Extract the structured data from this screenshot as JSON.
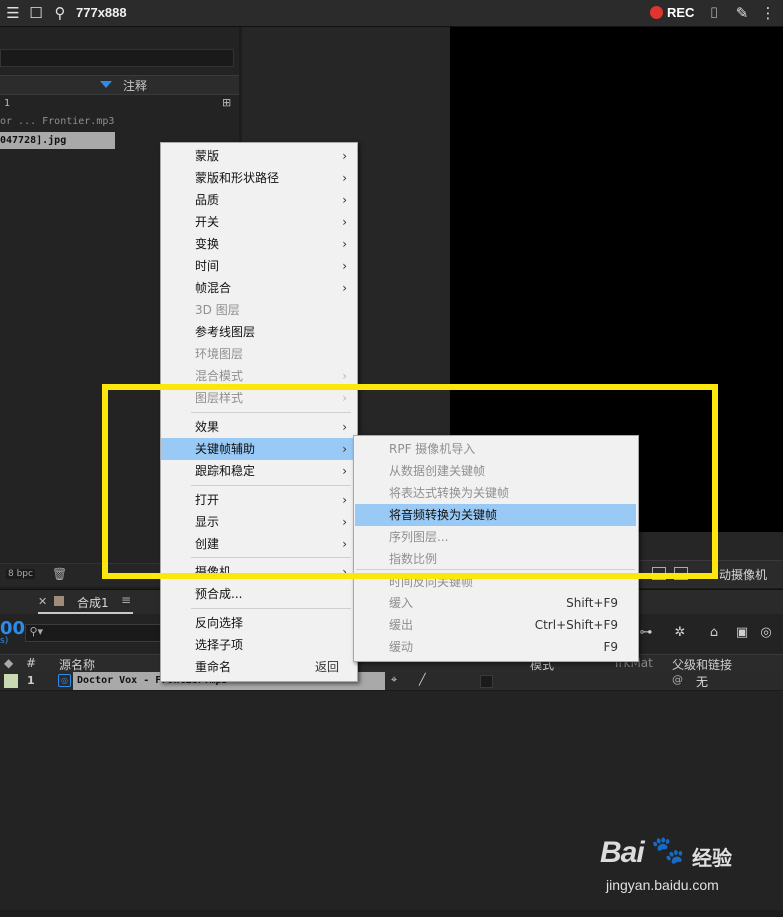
{
  "recorder": {
    "title": "777x888",
    "rec_label": "REC",
    "rec_color": "#e0352f"
  },
  "project_panel": {
    "column_header": "注释",
    "row0": "1",
    "row1": "or ... Frontier.mp3",
    "row2": "047728].jpg",
    "bpc": "8 bpc"
  },
  "comp_viewer": {
    "camera_label": "动摄像机"
  },
  "timeline": {
    "tab_label": "合成1",
    "tab_menu": "≡",
    "time_display": "00",
    "time_sub": "s)",
    "columns": {
      "num": "#",
      "source_name": "源名称",
      "mode": "模式",
      "trkmat": "TrkMat",
      "parent": "父级和链接"
    },
    "layer": {
      "num": "1",
      "name": "Doctor Vox - Frontier.mp3",
      "parent_value": "无",
      "label_color": "#c8d9b4"
    }
  },
  "context_menu": {
    "items": [
      {
        "label": "蒙版",
        "submenu": true
      },
      {
        "label": "蒙版和形状路径",
        "submenu": true
      },
      {
        "label": "品质",
        "submenu": true
      },
      {
        "label": "开关",
        "submenu": true
      },
      {
        "label": "变换",
        "submenu": true
      },
      {
        "label": "时间",
        "submenu": true
      },
      {
        "label": "帧混合",
        "submenu": true
      },
      {
        "label": "3D 图层",
        "disabled": true
      },
      {
        "label": "参考线图层"
      },
      {
        "label": "环境图层",
        "disabled": true
      },
      {
        "label": "混合模式",
        "submenu": true,
        "disabled": true
      },
      {
        "label": "图层样式",
        "submenu": true,
        "disabled": true
      },
      {
        "label": "效果",
        "submenu": true
      },
      {
        "label": "关键帧辅助",
        "submenu": true,
        "highlighted": true
      },
      {
        "label": "跟踪和稳定",
        "submenu": true
      },
      {
        "label": "打开",
        "submenu": true
      },
      {
        "label": "显示",
        "submenu": true
      },
      {
        "label": "创建",
        "submenu": true
      },
      {
        "label": "摄像机",
        "submenu": true
      },
      {
        "label": "预合成..."
      },
      {
        "label": "反向选择"
      },
      {
        "label": "选择子项"
      },
      {
        "label": "重命名",
        "shortcut": "返回"
      }
    ]
  },
  "keyframe_submenu": {
    "items": [
      {
        "label": "RPF 摄像机导入",
        "disabled": true
      },
      {
        "label": "从数据创建关键帧",
        "disabled": true
      },
      {
        "label": "将表达式转换为关键帧",
        "disabled": true
      },
      {
        "label": "将音频转换为关键帧",
        "highlighted": true
      },
      {
        "label": "序列图层...",
        "disabled": true
      },
      {
        "label": "指数比例",
        "disabled": true
      },
      {
        "label": "时间反向关键帧",
        "disabled": true
      },
      {
        "label": "缓入",
        "shortcut": "Shift+F9",
        "disabled": true
      },
      {
        "label": "缓出",
        "shortcut": "Ctrl+Shift+F9",
        "disabled": true
      },
      {
        "label": "缓动",
        "shortcut": "F9",
        "disabled": true
      }
    ]
  },
  "annotation": {
    "highlight_color": "#fbe70a"
  },
  "watermark": {
    "bai": "Bai",
    "jingyan": "经验",
    "url": "jingyan.baidu.com"
  }
}
